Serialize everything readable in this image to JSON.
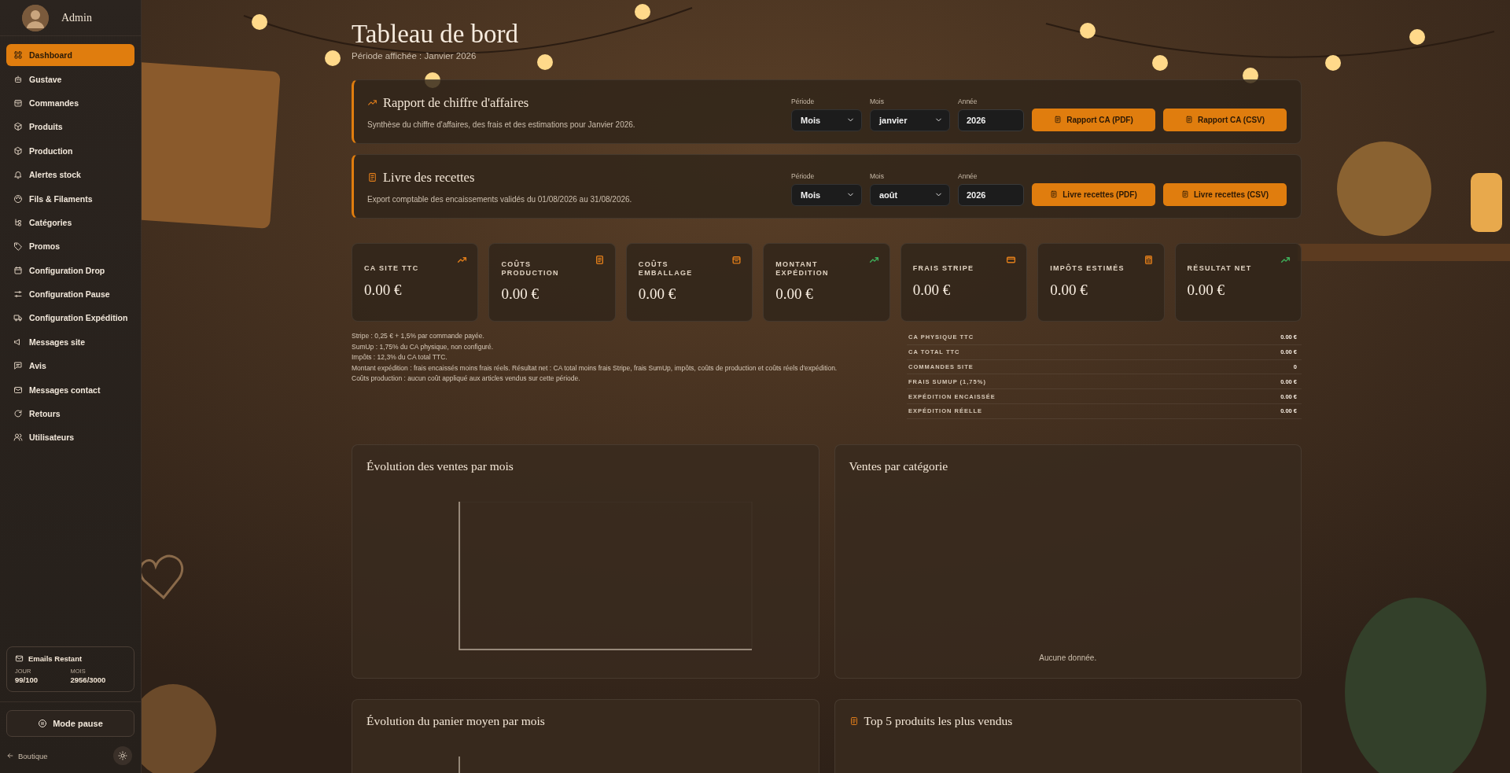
{
  "sidebar": {
    "user": "Admin",
    "items": [
      {
        "label": "Dashboard",
        "kind": "grid",
        "selected": true
      },
      {
        "label": "Gustave",
        "kind": "robot",
        "selected": false
      },
      {
        "label": "Commandes",
        "kind": "bag",
        "selected": false
      },
      {
        "label": "Produits",
        "kind": "cube",
        "selected": false
      },
      {
        "label": "Production",
        "kind": "cube",
        "selected": false
      },
      {
        "label": "Alertes stock",
        "kind": "bell",
        "selected": false
      },
      {
        "label": "Fils & Filaments",
        "kind": "palette",
        "selected": false
      },
      {
        "label": "Catégories",
        "kind": "hierarchy",
        "selected": false
      },
      {
        "label": "Promos",
        "kind": "tag",
        "selected": false
      },
      {
        "label": "Configuration Drop",
        "kind": "calendar",
        "selected": false
      },
      {
        "label": "Configuration Pause",
        "kind": "sliders",
        "selected": false
      },
      {
        "label": "Configuration Expédition",
        "kind": "truck",
        "selected": false
      },
      {
        "label": "Messages site",
        "kind": "megaphone",
        "selected": false
      },
      {
        "label": "Avis",
        "kind": "chat",
        "selected": false
      },
      {
        "label": "Messages contact",
        "kind": "mail",
        "selected": false
      },
      {
        "label": "Retours",
        "kind": "refresh",
        "selected": false
      },
      {
        "label": "Utilisateurs",
        "kind": "users",
        "selected": false
      }
    ],
    "emails": {
      "title": "Emails Restant",
      "day_label": "JOUR",
      "day_value": "99/100",
      "month_label": "MOIS",
      "month_value": "2956/3000"
    },
    "pause_button": "Mode pause",
    "back_link": "Boutique"
  },
  "header": {
    "title": "Tableau de bord",
    "subtitle": "Période affichée : Janvier 2026"
  },
  "reports": [
    {
      "kind": "trend",
      "title": "Rapport de chiffre d'affaires",
      "description": "Synthèse du chiffre d'affaires, des frais et des estimations pour Janvier 2026.",
      "period_label": "Période",
      "period": "Mois",
      "month_label": "Mois",
      "month": "janvier",
      "year_label": "Année",
      "year": "2026",
      "buttons": [
        "Rapport CA (PDF)",
        "Rapport CA (CSV)"
      ]
    },
    {
      "kind": "doc",
      "title": "Livre des recettes",
      "description": "Export comptable des encaissements validés du 01/08/2026 au 31/08/2026.",
      "period_label": "Période",
      "period": "Mois",
      "month_label": "Mois",
      "month": "août",
      "year_label": "Année",
      "year": "2026",
      "buttons": [
        "Livre recettes (PDF)",
        "Livre recettes (CSV)"
      ]
    }
  ],
  "kpis": [
    {
      "label": "CA SITE TTC",
      "value": "0.00 €",
      "kind": "trend",
      "color": "#e07d1a"
    },
    {
      "label": "COÛTS PRODUCTION",
      "value": "0.00 €",
      "kind": "doc",
      "color": "#e07d1a"
    },
    {
      "label": "COÛTS EMBALLAGE",
      "value": "0.00 €",
      "kind": "bag",
      "color": "#e07d1a"
    },
    {
      "label": "MONTANT EXPÉDITION",
      "value": "0.00 €",
      "kind": "trend",
      "color": "#3fae5a"
    },
    {
      "label": "FRAIS STRIPE",
      "value": "0.00 €",
      "kind": "card",
      "color": "#e07d1a"
    },
    {
      "label": "IMPÔTS ESTIMÉS",
      "value": "0.00 €",
      "kind": "calc",
      "color": "#e07d1a"
    },
    {
      "label": "RÉSULTAT NET",
      "value": "0.00 €",
      "kind": "trend",
      "color": "#3fae5a"
    }
  ],
  "notes": [
    "Stripe : 0,25 € + 1,5% par commande payée.",
    "SumUp : 1,75% du CA physique, non configuré.",
    "Impôts : 12,3% du CA total TTC.",
    "Montant expédition : frais encaissés moins frais réels. Résultat net : CA total moins frais Stripe, frais SumUp, impôts, coûts de production et coûts réels d'expédition.",
    "Coûts production : aucun coût appliqué aux articles vendus sur cette période."
  ],
  "summary": [
    {
      "label": "CA PHYSIQUE TTC",
      "value": "0.00 €"
    },
    {
      "label": "CA TOTAL TTC",
      "value": "0.00 €"
    },
    {
      "label": "COMMANDES SITE",
      "value": "0"
    },
    {
      "label": "FRAIS SUMUP (1,75%)",
      "value": "0.00 €"
    },
    {
      "label": "EXPÉDITION ENCAISSÉE",
      "value": "0.00 €"
    },
    {
      "label": "EXPÉDITION RÉELLE",
      "value": "0.00 €"
    }
  ],
  "charts": [
    {
      "title": "Évolution des ventes par mois",
      "kind": "axes"
    },
    {
      "title": "Ventes par catégorie",
      "kind": "empty",
      "empty_text": "Aucune donnée."
    },
    {
      "title": "Évolution du panier moyen par mois",
      "kind": "axes"
    },
    {
      "title": "Top 5 produits les plus vendus",
      "kind": "list"
    }
  ]
}
